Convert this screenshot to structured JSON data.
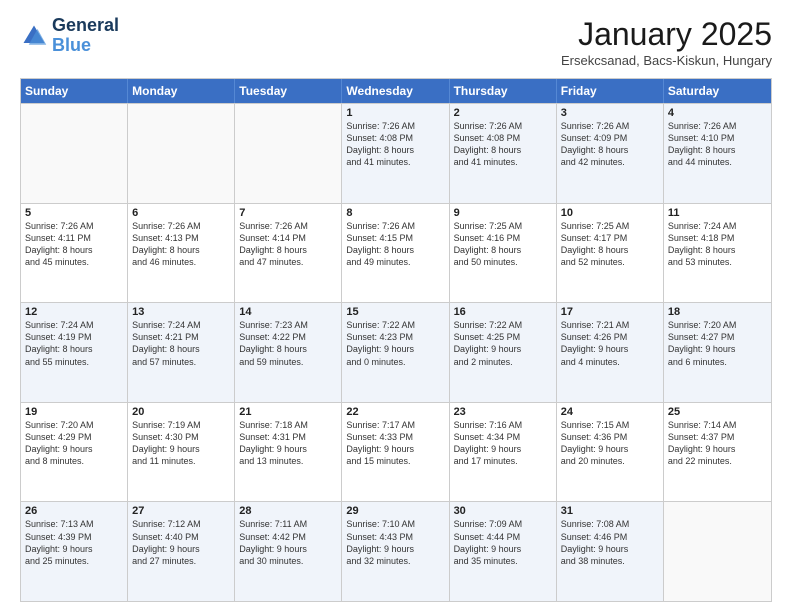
{
  "header": {
    "logo_line1": "General",
    "logo_line2": "Blue",
    "month": "January 2025",
    "location": "Ersekcsanad, Bacs-Kiskun, Hungary"
  },
  "days_of_week": [
    "Sunday",
    "Monday",
    "Tuesday",
    "Wednesday",
    "Thursday",
    "Friday",
    "Saturday"
  ],
  "rows": [
    [
      {
        "day": "",
        "lines": [],
        "empty": true
      },
      {
        "day": "",
        "lines": [],
        "empty": true
      },
      {
        "day": "",
        "lines": [],
        "empty": true
      },
      {
        "day": "1",
        "lines": [
          "Sunrise: 7:26 AM",
          "Sunset: 4:08 PM",
          "Daylight: 8 hours",
          "and 41 minutes."
        ]
      },
      {
        "day": "2",
        "lines": [
          "Sunrise: 7:26 AM",
          "Sunset: 4:08 PM",
          "Daylight: 8 hours",
          "and 41 minutes."
        ]
      },
      {
        "day": "3",
        "lines": [
          "Sunrise: 7:26 AM",
          "Sunset: 4:09 PM",
          "Daylight: 8 hours",
          "and 42 minutes."
        ]
      },
      {
        "day": "4",
        "lines": [
          "Sunrise: 7:26 AM",
          "Sunset: 4:10 PM",
          "Daylight: 8 hours",
          "and 44 minutes."
        ]
      }
    ],
    [
      {
        "day": "5",
        "lines": [
          "Sunrise: 7:26 AM",
          "Sunset: 4:11 PM",
          "Daylight: 8 hours",
          "and 45 minutes."
        ]
      },
      {
        "day": "6",
        "lines": [
          "Sunrise: 7:26 AM",
          "Sunset: 4:13 PM",
          "Daylight: 8 hours",
          "and 46 minutes."
        ]
      },
      {
        "day": "7",
        "lines": [
          "Sunrise: 7:26 AM",
          "Sunset: 4:14 PM",
          "Daylight: 8 hours",
          "and 47 minutes."
        ]
      },
      {
        "day": "8",
        "lines": [
          "Sunrise: 7:26 AM",
          "Sunset: 4:15 PM",
          "Daylight: 8 hours",
          "and 49 minutes."
        ]
      },
      {
        "day": "9",
        "lines": [
          "Sunrise: 7:25 AM",
          "Sunset: 4:16 PM",
          "Daylight: 8 hours",
          "and 50 minutes."
        ]
      },
      {
        "day": "10",
        "lines": [
          "Sunrise: 7:25 AM",
          "Sunset: 4:17 PM",
          "Daylight: 8 hours",
          "and 52 minutes."
        ]
      },
      {
        "day": "11",
        "lines": [
          "Sunrise: 7:24 AM",
          "Sunset: 4:18 PM",
          "Daylight: 8 hours",
          "and 53 minutes."
        ]
      }
    ],
    [
      {
        "day": "12",
        "lines": [
          "Sunrise: 7:24 AM",
          "Sunset: 4:19 PM",
          "Daylight: 8 hours",
          "and 55 minutes."
        ]
      },
      {
        "day": "13",
        "lines": [
          "Sunrise: 7:24 AM",
          "Sunset: 4:21 PM",
          "Daylight: 8 hours",
          "and 57 minutes."
        ]
      },
      {
        "day": "14",
        "lines": [
          "Sunrise: 7:23 AM",
          "Sunset: 4:22 PM",
          "Daylight: 8 hours",
          "and 59 minutes."
        ]
      },
      {
        "day": "15",
        "lines": [
          "Sunrise: 7:22 AM",
          "Sunset: 4:23 PM",
          "Daylight: 9 hours",
          "and 0 minutes."
        ]
      },
      {
        "day": "16",
        "lines": [
          "Sunrise: 7:22 AM",
          "Sunset: 4:25 PM",
          "Daylight: 9 hours",
          "and 2 minutes."
        ]
      },
      {
        "day": "17",
        "lines": [
          "Sunrise: 7:21 AM",
          "Sunset: 4:26 PM",
          "Daylight: 9 hours",
          "and 4 minutes."
        ]
      },
      {
        "day": "18",
        "lines": [
          "Sunrise: 7:20 AM",
          "Sunset: 4:27 PM",
          "Daylight: 9 hours",
          "and 6 minutes."
        ]
      }
    ],
    [
      {
        "day": "19",
        "lines": [
          "Sunrise: 7:20 AM",
          "Sunset: 4:29 PM",
          "Daylight: 9 hours",
          "and 8 minutes."
        ]
      },
      {
        "day": "20",
        "lines": [
          "Sunrise: 7:19 AM",
          "Sunset: 4:30 PM",
          "Daylight: 9 hours",
          "and 11 minutes."
        ]
      },
      {
        "day": "21",
        "lines": [
          "Sunrise: 7:18 AM",
          "Sunset: 4:31 PM",
          "Daylight: 9 hours",
          "and 13 minutes."
        ]
      },
      {
        "day": "22",
        "lines": [
          "Sunrise: 7:17 AM",
          "Sunset: 4:33 PM",
          "Daylight: 9 hours",
          "and 15 minutes."
        ]
      },
      {
        "day": "23",
        "lines": [
          "Sunrise: 7:16 AM",
          "Sunset: 4:34 PM",
          "Daylight: 9 hours",
          "and 17 minutes."
        ]
      },
      {
        "day": "24",
        "lines": [
          "Sunrise: 7:15 AM",
          "Sunset: 4:36 PM",
          "Daylight: 9 hours",
          "and 20 minutes."
        ]
      },
      {
        "day": "25",
        "lines": [
          "Sunrise: 7:14 AM",
          "Sunset: 4:37 PM",
          "Daylight: 9 hours",
          "and 22 minutes."
        ]
      }
    ],
    [
      {
        "day": "26",
        "lines": [
          "Sunrise: 7:13 AM",
          "Sunset: 4:39 PM",
          "Daylight: 9 hours",
          "and 25 minutes."
        ]
      },
      {
        "day": "27",
        "lines": [
          "Sunrise: 7:12 AM",
          "Sunset: 4:40 PM",
          "Daylight: 9 hours",
          "and 27 minutes."
        ]
      },
      {
        "day": "28",
        "lines": [
          "Sunrise: 7:11 AM",
          "Sunset: 4:42 PM",
          "Daylight: 9 hours",
          "and 30 minutes."
        ]
      },
      {
        "day": "29",
        "lines": [
          "Sunrise: 7:10 AM",
          "Sunset: 4:43 PM",
          "Daylight: 9 hours",
          "and 32 minutes."
        ]
      },
      {
        "day": "30",
        "lines": [
          "Sunrise: 7:09 AM",
          "Sunset: 4:44 PM",
          "Daylight: 9 hours",
          "and 35 minutes."
        ]
      },
      {
        "day": "31",
        "lines": [
          "Sunrise: 7:08 AM",
          "Sunset: 4:46 PM",
          "Daylight: 9 hours",
          "and 38 minutes."
        ]
      },
      {
        "day": "",
        "lines": [],
        "empty": true
      }
    ]
  ],
  "alt_rows": [
    0,
    2,
    4
  ]
}
